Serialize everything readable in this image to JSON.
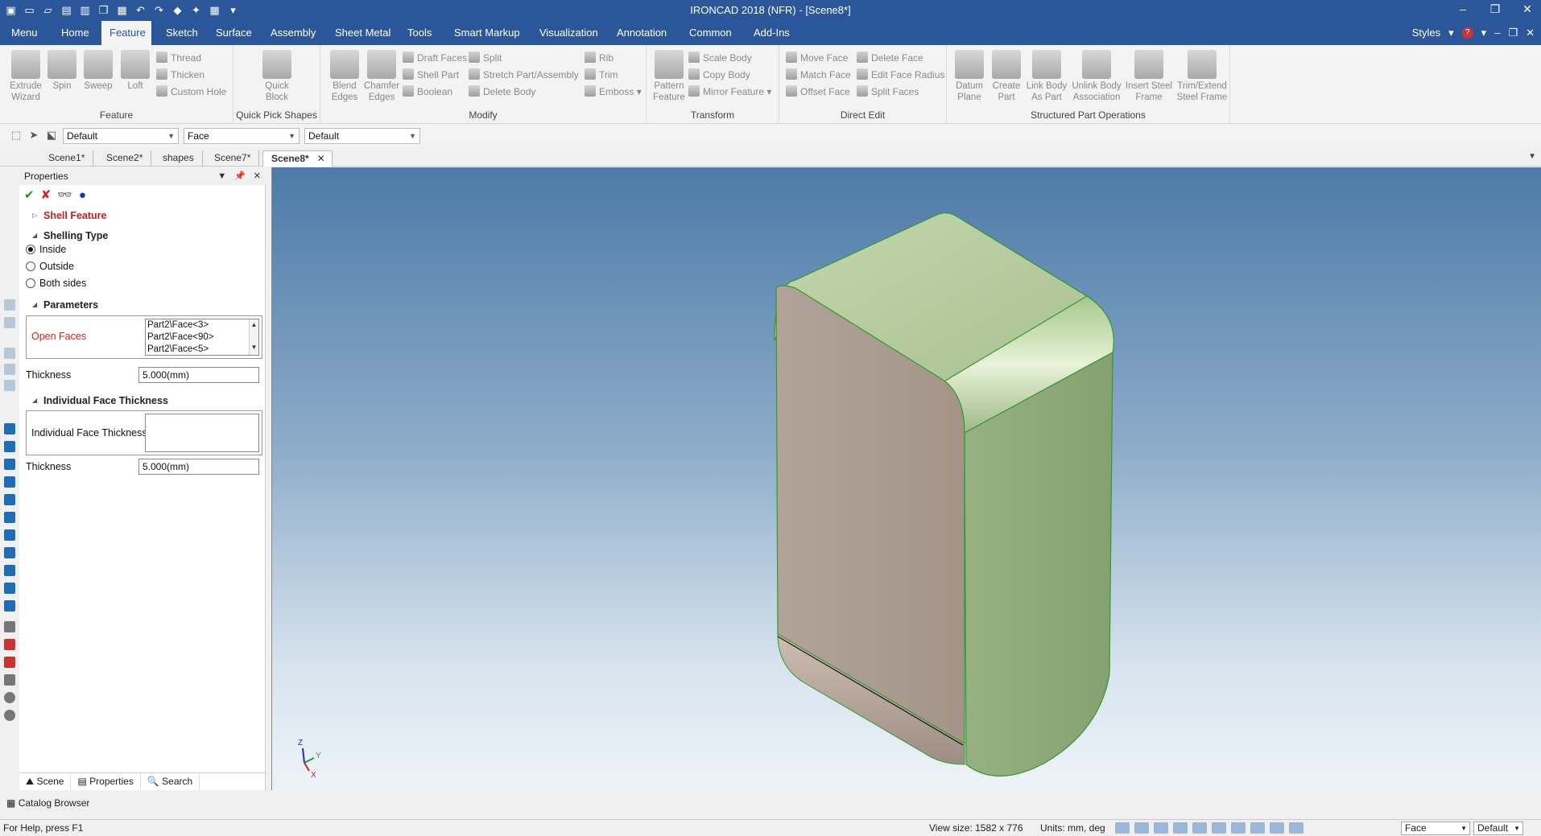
{
  "window": {
    "title": "IRONCAD 2018 (NFR) - [Scene8*]"
  },
  "qat_icons": [
    "new-icon",
    "open-icon",
    "save-icon",
    "print-icon",
    "undo-icon",
    "redo-icon",
    "smart-icon",
    "customize-icon"
  ],
  "menu_tabs": [
    "Menu",
    "Home",
    "Feature",
    "Sketch",
    "Surface",
    "Assembly",
    "Sheet Metal",
    "Tools",
    "Smart Markup",
    "Visualization",
    "Annotation",
    "Common",
    "Add-Ins"
  ],
  "menu_active": "Feature",
  "styles_label": "Styles",
  "ribbon": {
    "feature": {
      "label": "Feature",
      "buttons": [
        {
          "name": "extrude-wizard-button",
          "label": "Extrude\nWizard"
        },
        {
          "name": "spin-button",
          "label": "Spin"
        },
        {
          "name": "sweep-button",
          "label": "Sweep"
        },
        {
          "name": "loft-button",
          "label": "Loft"
        }
      ],
      "small": [
        "Thread",
        "Thicken",
        "Custom Hole"
      ]
    },
    "quick_pick": {
      "label": "Quick Pick Shapes",
      "button": "Quick\nBlock"
    },
    "modify": {
      "label": "Modify",
      "buttons": [
        {
          "name": "blend-edges-button",
          "label": "Blend\nEdges"
        },
        {
          "name": "chamfer-edges-button",
          "label": "Chamfer\nEdges"
        }
      ],
      "col1": [
        "Draft Faces",
        "Shell Part",
        "Boolean"
      ],
      "col2": [
        "Split",
        "Stretch Part/Assembly",
        "Delete Body"
      ],
      "col3": [
        "Rib",
        "Trim",
        "Emboss"
      ]
    },
    "transform": {
      "label": "Transform",
      "button": "Pattern\nFeature",
      "small": [
        "Scale Body",
        "Copy Body",
        "Mirror Feature"
      ]
    },
    "direct_edit": {
      "label": "Direct Edit",
      "col1": [
        "Move Face",
        "Match Face",
        "Offset Face"
      ],
      "col2": [
        "Delete Face",
        "Edit Face Radius",
        "Split Faces"
      ]
    },
    "structured": {
      "label": "Structured Part Operations",
      "buttons": [
        "Datum\nPlane",
        "Create\nPart",
        "Link Body\nAs Part",
        "Unlink Body\nAssociation",
        "Insert Steel\nFrame",
        "Trim/Extend\nSteel Frame"
      ]
    }
  },
  "toolbar": {
    "dd1": "Default",
    "dd2": "Face",
    "dd3": "Default"
  },
  "doc_tabs": [
    "Scene1*",
    "Scene2*",
    "shapes",
    "Scene7*",
    "Scene8*"
  ],
  "doc_active": "Scene8*",
  "properties": {
    "title": "Properties",
    "shell_feature": "Shell Feature",
    "shelling_type": "Shelling Type",
    "options": [
      "Inside",
      "Outside",
      "Both sides"
    ],
    "selected": "Inside",
    "parameters": "Parameters",
    "open_faces_label": "Open Faces",
    "open_faces": [
      "Part2\\Face<3>",
      "Part2\\Face<90>",
      "Part2\\Face<5>"
    ],
    "thickness_label": "Thickness",
    "thickness_value": "5.000(mm)",
    "individual_section": "Individual Face Thickness",
    "individual_label": "Individual Face Thickness",
    "thickness2_label": "Thickness",
    "thickness2_value": "5.000(mm)",
    "bottom_tabs": [
      "Scene",
      "Properties",
      "Search"
    ]
  },
  "catalog_label": "Catalog Browser",
  "status": {
    "help": "For Help, press F1",
    "view_size": "View size: 1582 x 776",
    "units": "Units: mm, deg",
    "select_mode": "Face",
    "style": "Default"
  },
  "model_colors": {
    "top": "#b5cc9d",
    "right": "#8fa878",
    "front": "#ab9d92",
    "edge": "#2e9c2e"
  }
}
